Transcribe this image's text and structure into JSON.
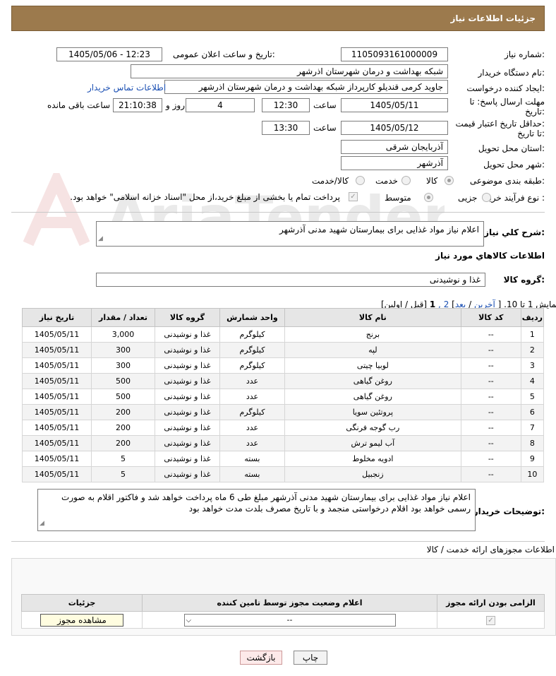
{
  "header": {
    "title": "جزئیات اطلاعات نیاز"
  },
  "form": {
    "need_number_label": "شماره نیاز:",
    "need_number": "1105093161000009",
    "announce_label": "تاریخ و ساعت اعلان عمومی:",
    "announce_value": "1405/05/06 - 12:23",
    "buyer_label": "نام دستگاه خریدار:",
    "buyer_value": "شبکه بهداشت و درمان شهرستان اذرشهر",
    "creator_label": "ایجاد کننده درخواست:",
    "creator_value": "جاوید کرمی قندیلو کارپرداز شبکه بهداشت و درمان شهرستان اذرشهر",
    "contact_link": "اطلاعات تماس خریدار",
    "deadline_label_1": "مهلت ارسال پاسخ: تا",
    "deadline_label_2": "تاریخ:",
    "deadline_date": "1405/05/11",
    "time_label": "ساعت",
    "deadline_time": "12:30",
    "days_value": "4",
    "days_label": "روز و",
    "remaining_time": "21:10:38",
    "remaining_label": "ساعت باقی مانده",
    "validity_label_1": "حداقل تاریخ اعتبار قیمت:",
    "validity_label_2": "تا تاریخ:",
    "validity_date": "1405/05/12",
    "validity_time": "13:30",
    "province_label": "استان محل تحویل:",
    "province_value": "آذربایجان شرقی",
    "city_label": "شهر محل تحویل:",
    "city_value": "آذرشهر",
    "category_label": "طبقه بندی موضوعی:",
    "category_options": [
      "کالا",
      "خدمت",
      "کالا/خدمت"
    ],
    "process_label": "نوع فرآیند خرید :",
    "process_options": [
      "جزیی",
      "متوسط"
    ],
    "payment_note": "پرداخت تمام یا بخشی از مبلغ خرید،از محل \"اسناد خزانه اسلامی\" خواهد بود."
  },
  "description": {
    "label": "شرح کلي نياز:",
    "value": "اعلام نیاز مواد غذایی برای بیمارستان شهید مدنی آذرشهر"
  },
  "goods_section": {
    "title": "اطلاعات کالاهاي مورد نياز",
    "group_label": "گروه کالا:",
    "group_value": "غذا و نوشیدنی"
  },
  "pager": {
    "text_prefix": "نمایش 1 تا 10. [",
    "last": "آخرین",
    "next": "بعد",
    "pages": "2 ,",
    "current": "1",
    "text_suffix": "[قبل / اولین]"
  },
  "table": {
    "headers": [
      "ردیف",
      "کد کالا",
      "نام کالا",
      "واحد شمارش",
      "گروه کالا",
      "تعداد / مقدار",
      "تاریخ نیاز"
    ],
    "rows": [
      [
        "1",
        "--",
        "برنج",
        "کیلوگرم",
        "غذا و نوشیدنی",
        "3,000",
        "1405/05/11"
      ],
      [
        "2",
        "--",
        "لپه",
        "کیلوگرم",
        "غذا و نوشیدنی",
        "300",
        "1405/05/11"
      ],
      [
        "3",
        "--",
        "لوبیا چیتی",
        "کیلوگرم",
        "غذا و نوشیدنی",
        "300",
        "1405/05/11"
      ],
      [
        "4",
        "--",
        "روغن گیاهی",
        "عدد",
        "غذا و نوشیدنی",
        "500",
        "1405/05/11"
      ],
      [
        "5",
        "--",
        "روغن گیاهی",
        "عدد",
        "غذا و نوشیدنی",
        "500",
        "1405/05/11"
      ],
      [
        "6",
        "--",
        "پروتئین سویا",
        "کیلوگرم",
        "غذا و نوشیدنی",
        "200",
        "1405/05/11"
      ],
      [
        "7",
        "--",
        "رب گوجه فرنگی",
        "عدد",
        "غذا و نوشیدنی",
        "200",
        "1405/05/11"
      ],
      [
        "8",
        "--",
        "آب لیمو ترش",
        "عدد",
        "غذا و نوشیدنی",
        "200",
        "1405/05/11"
      ],
      [
        "9",
        "--",
        "ادویه مخلوط",
        "بسته",
        "غذا و نوشیدنی",
        "5",
        "1405/05/11"
      ],
      [
        "10",
        "--",
        "زنجبیل",
        "بسته",
        "غذا و نوشیدنی",
        "5",
        "1405/05/11"
      ]
    ]
  },
  "buyer_notes": {
    "label": "توضیحات خریدار:",
    "value": "اعلام نیاز مواد غذایی برای بیمارستان شهید مدنی آذرشهر مبلغ طی 6 ماه پرداخت خواهد شد و فاکتور اقلام به صورت رسمی خواهد بود اقلام درخواستی منجمد و با تاریخ مصرف بلدت مدت خواهد بود"
  },
  "permits": {
    "title": "اطلاعات مجوزهای ارائه خدمت / کالا",
    "headers": [
      "الزامی بودن ارائه مجوز",
      "اعلام وضعیت مجوز توسط تامین کننده",
      "جزئیات"
    ],
    "select_value": "--",
    "view_button": "مشاهده مجوز"
  },
  "buttons": {
    "print": "چاپ",
    "back": "بازگشت"
  },
  "watermark": "AriaTender.net"
}
